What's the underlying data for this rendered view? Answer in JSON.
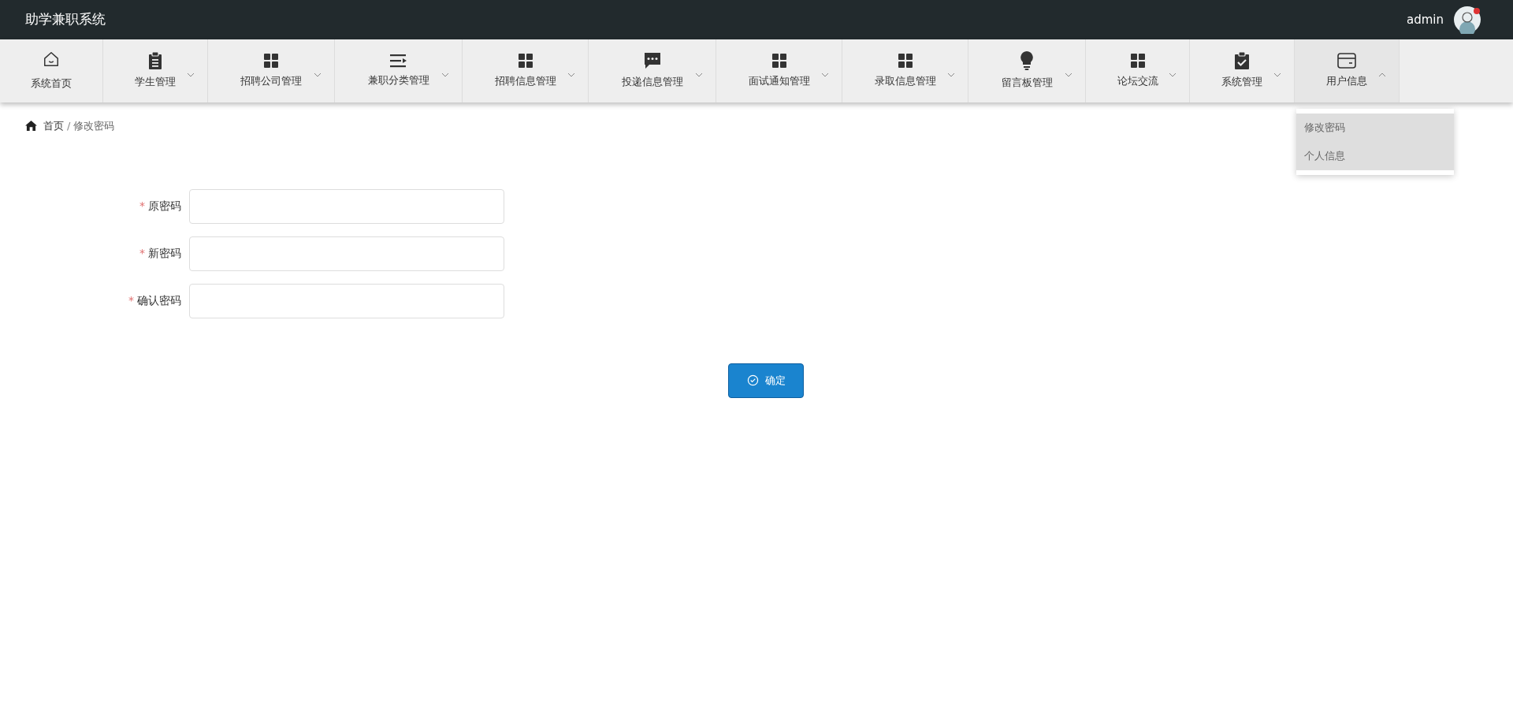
{
  "header": {
    "title": "助学兼职系统",
    "user": "admin"
  },
  "nav": [
    {
      "label": "系统首页",
      "kind": "link"
    },
    {
      "label": "学生管理",
      "kind": "menu",
      "expanded": false
    },
    {
      "label": "招聘公司管理",
      "kind": "menu",
      "expanded": false
    },
    {
      "label": "兼职分类管理",
      "kind": "menu",
      "expanded": false
    },
    {
      "label": "招聘信息管理",
      "kind": "menu",
      "expanded": false
    },
    {
      "label": "投递信息管理",
      "kind": "menu",
      "expanded": false
    },
    {
      "label": "面试通知管理",
      "kind": "menu",
      "expanded": false
    },
    {
      "label": "录取信息管理",
      "kind": "menu",
      "expanded": false
    },
    {
      "label": "留言板管理",
      "kind": "menu",
      "expanded": false
    },
    {
      "label": "论坛交流",
      "kind": "menu",
      "expanded": false
    },
    {
      "label": "系统管理",
      "kind": "menu",
      "expanded": false
    },
    {
      "label": "用户信息",
      "kind": "menu",
      "expanded": true,
      "submenu": [
        "修改密码",
        "个人信息"
      ]
    }
  ],
  "breadcrumb": {
    "items": [
      "首页",
      "修改密码"
    ],
    "separator": "/"
  },
  "form": {
    "fields": [
      {
        "marker": "*",
        "label": "原密码"
      },
      {
        "marker": "*",
        "label": "新密码"
      },
      {
        "marker": "*",
        "label": "确认密码"
      }
    ],
    "submit": "确定"
  }
}
